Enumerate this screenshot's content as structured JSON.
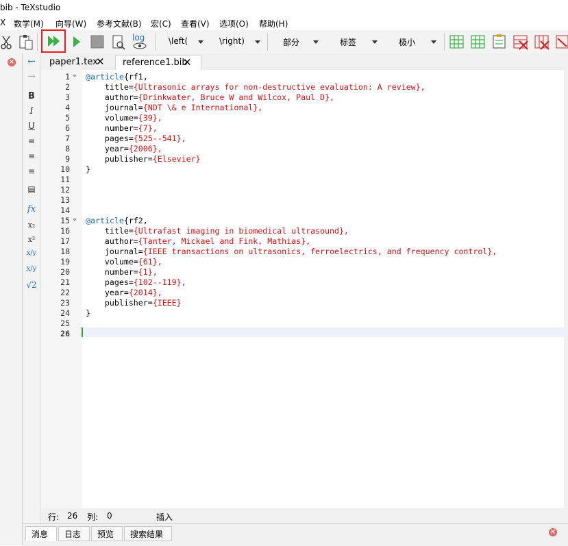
{
  "window": {
    "title": "bib - TeXstudio"
  },
  "menu": {
    "items": [
      "X",
      "数学(M)",
      "向导(W)",
      "参考文献(B)",
      "宏(C)",
      "查看(V)",
      "选项(O)",
      "帮助(H)"
    ]
  },
  "toolbar": {
    "left_delim": "\\left(",
    "right_delim": "\\right)",
    "section": "部分",
    "label": "标签",
    "size": "极小",
    "log_label": "log",
    "highlight_color": "#e02020"
  },
  "tabs": [
    {
      "label": "paper1.tex",
      "active": false
    },
    {
      "label": "reference1.bib",
      "active": true
    }
  ],
  "editor": {
    "line_numbers": [
      "1",
      "2",
      "3",
      "4",
      "5",
      "6",
      "7",
      "8",
      "9",
      "10",
      "11",
      "12",
      "13",
      "14",
      "15",
      "16",
      "17",
      "18",
      "19",
      "20",
      "21",
      "22",
      "23",
      "24",
      "25",
      "26"
    ],
    "lines": [
      [
        "@article",
        "{rf1,"
      ],
      [
        "    title=",
        "{Ultrasonic arrays for non-destructive evaluation: A review},"
      ],
      [
        "    author=",
        "{Drinkwater, Bruce W and Wilcox, Paul D},"
      ],
      [
        "    journal=",
        "{NDT \\& e International},"
      ],
      [
        "    volume=",
        "{39},"
      ],
      [
        "    number=",
        "{7},"
      ],
      [
        "    pages=",
        "{525--541},"
      ],
      [
        "    year=",
        "{2006},"
      ],
      [
        "    publisher=",
        "{Elsevier}"
      ],
      [
        "}",
        ""
      ],
      [
        "",
        ""
      ],
      [
        "",
        ""
      ],
      [
        "",
        ""
      ],
      [
        "",
        ""
      ],
      [
        "@article",
        "{rf2,"
      ],
      [
        "    title=",
        "{Ultrafast imaging in biomedical ultrasound},"
      ],
      [
        "    author=",
        "{Tanter, Mickael and Fink, Mathias},"
      ],
      [
        "    journal=",
        "{IEEE transactions on ultrasonics, ferroelectrics, and frequency control},"
      ],
      [
        "    volume=",
        "{61},"
      ],
      [
        "    number=",
        "{1},"
      ],
      [
        "    pages=",
        "{102--119},"
      ],
      [
        "    year=",
        "{2014},"
      ],
      [
        "    publisher=",
        "{IEEE}"
      ],
      [
        "}",
        ""
      ],
      [
        "",
        ""
      ],
      [
        "",
        ""
      ]
    ],
    "keyword_color": "#1565c0",
    "value_color": "#d01010"
  },
  "status": {
    "row_label": "行:",
    "row": "26",
    "col_label": "列:",
    "col": "0",
    "mode": "插入"
  },
  "bottom_tabs": [
    "消息",
    "日志",
    "预览",
    "搜索结果"
  ]
}
